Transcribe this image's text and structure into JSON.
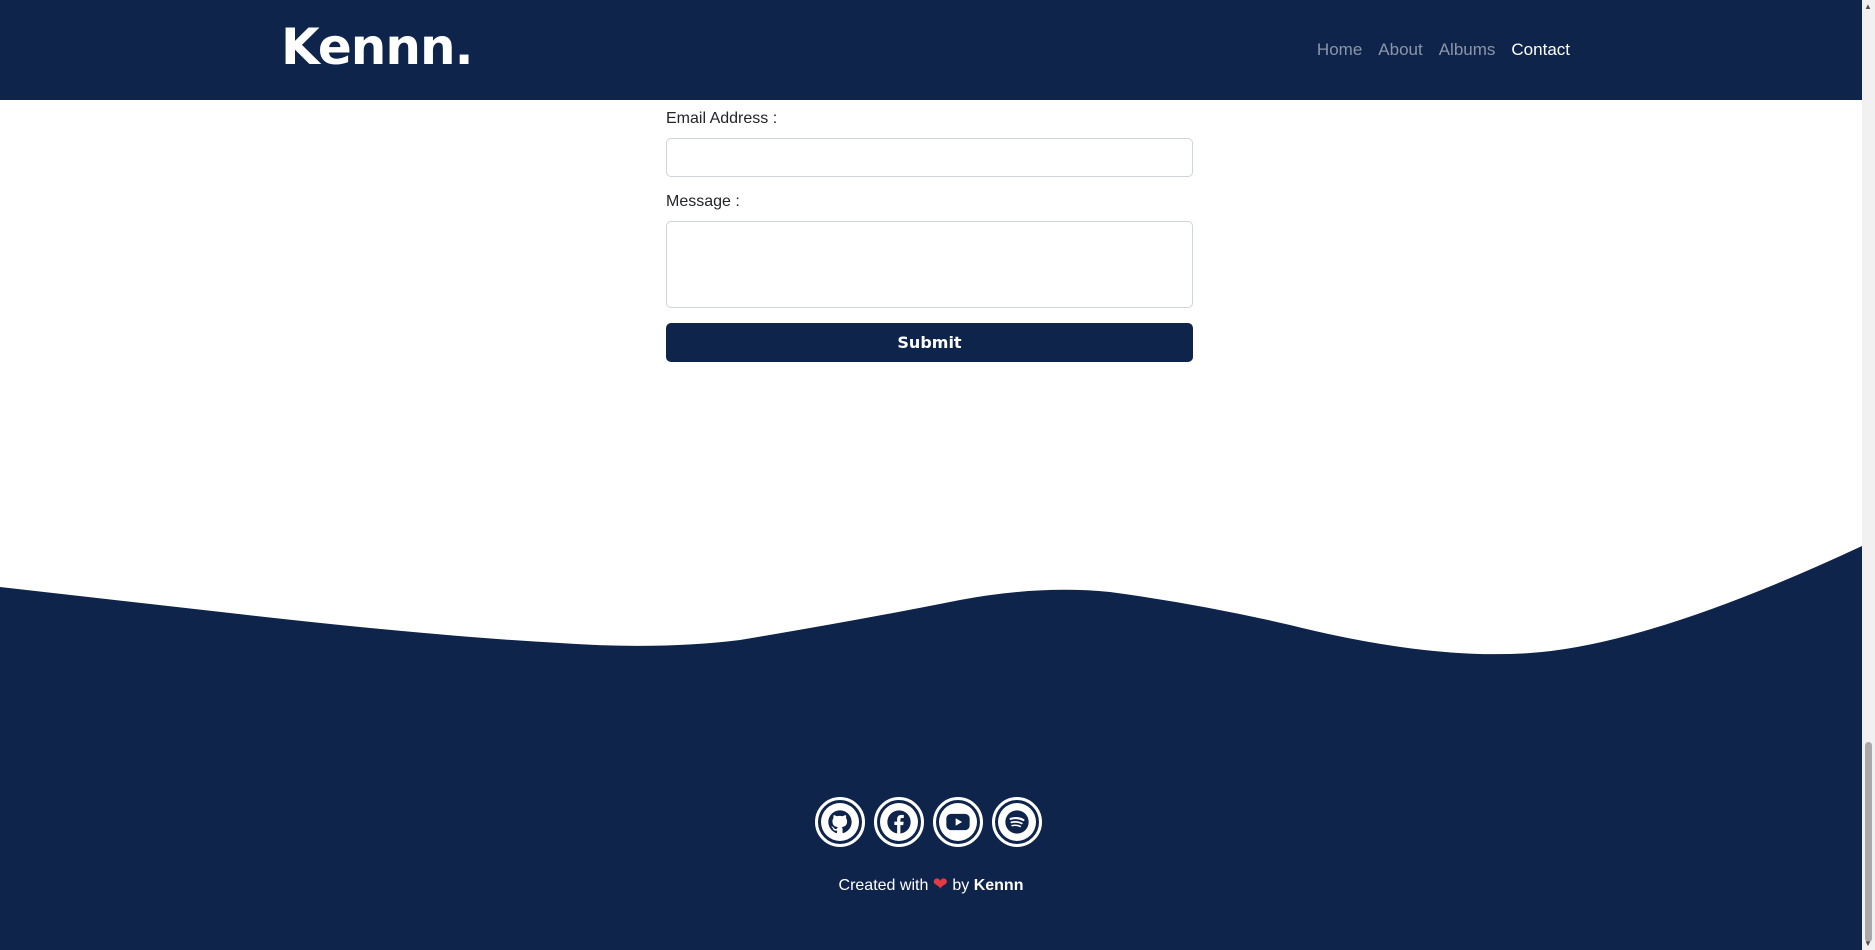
{
  "navbar": {
    "brand": "Kennn.",
    "links": [
      "Home",
      "About",
      "Albums",
      "Contact"
    ],
    "active": "Contact"
  },
  "form": {
    "email_label": "Email Address :",
    "email_value": "",
    "message_label": "Message :",
    "message_value": "",
    "submit_label": "Submit"
  },
  "footer": {
    "social_icons": [
      "github-icon",
      "facebook-icon",
      "youtube-icon",
      "spotify-icon"
    ],
    "credit_prefix": "Created with",
    "credit_heart": "❤",
    "credit_by": "by",
    "credit_author": "Kennn"
  },
  "colors": {
    "navy": "#0e244a",
    "heart": "#e63946",
    "nav_inactive": "#8d96a8",
    "white": "#ffffff"
  }
}
